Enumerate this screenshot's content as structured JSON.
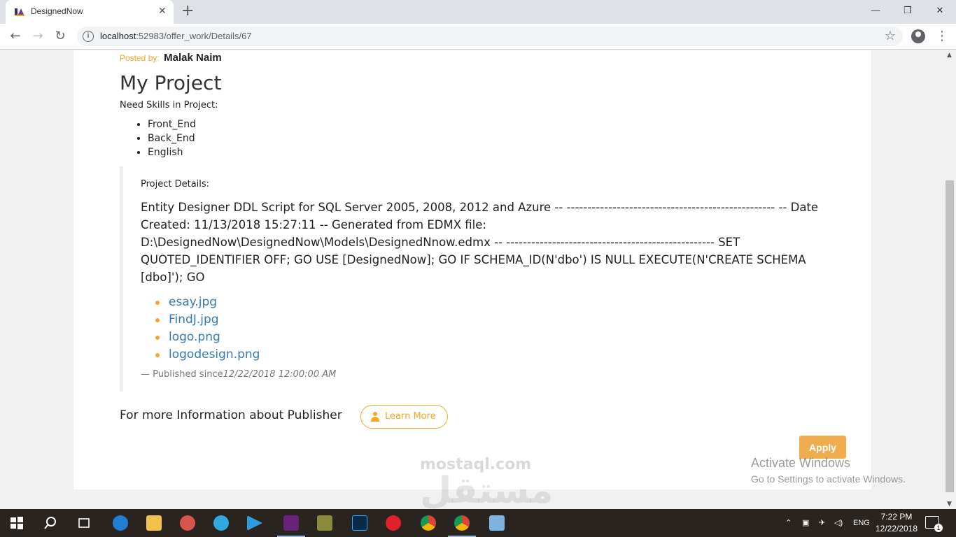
{
  "browser": {
    "tab_title": "DesignedNow",
    "tab_close": "✕",
    "new_tab": "+",
    "url_host": "localhost",
    "url_path": ":52983/offer_work/Details/67",
    "nav_back": "←",
    "nav_forward": "→",
    "nav_reload": "↻",
    "star": "☆",
    "menu": "⋮",
    "win_minimize": "—",
    "win_restore": "❐",
    "win_close": "✕"
  },
  "post": {
    "posted_label": "Posted by:",
    "posted_name": "Malak Naim",
    "title": "My Project",
    "skills_label": "Need Skills in Project:",
    "skills": [
      "Front_End",
      "Back_End",
      "English"
    ],
    "details_label": "Project Details:",
    "details_text": "Entity Designer DDL Script for SQL Server 2005, 2008, 2012 and Azure -- -------------------------------------------------- -- Date Created: 11/13/2018 15:27:11 -- Generated from EDMX file: D:\\DesignedNow\\DesignedNow\\Models\\DesignedNnow.edmx -- -------------------------------------------------- SET QUOTED_IDENTIFIER OFF; GO USE [DesignedNow]; GO IF SCHEMA_ID(N'dbo') IS NULL EXECUTE(N'CREATE SCHEMA [dbo]'); GO",
    "files": [
      "esay.jpg",
      "FindJ.jpg",
      "logo.png",
      "logodesign.png"
    ],
    "published_dash": "—",
    "published_label": "Published since",
    "published_date": "12/22/2018 12:00:00 AM",
    "more_info": "For more Information about Publisher",
    "learn_more": "Learn More",
    "apply": "Apply"
  },
  "overlay": {
    "activate_title": "Activate Windows",
    "activate_sub": "Go to Settings to activate Windows.",
    "watermark": "مستقل",
    "watermark_sub": "mostaql.com"
  },
  "taskbar": {
    "lang": "ENG",
    "time": "7:22 PM",
    "date": "12/22/2018",
    "notif_count": "1",
    "accent": "#f5a623"
  }
}
